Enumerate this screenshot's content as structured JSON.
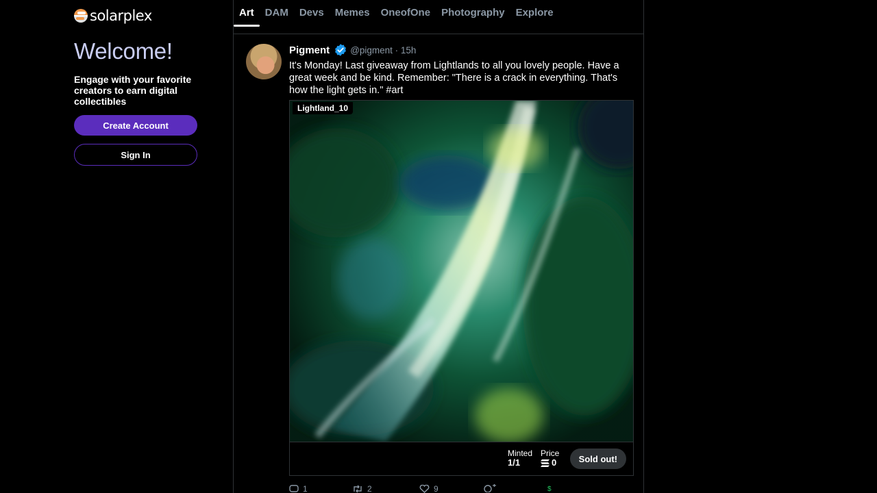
{
  "brand": {
    "name": "solarplex"
  },
  "sidebar": {
    "welcome": "Welcome!",
    "tagline": "Engage with your favorite creators to earn digital collectibles",
    "create_account": "Create Account",
    "sign_in": "Sign In"
  },
  "tabs": [
    {
      "label": "Art",
      "active": true
    },
    {
      "label": "DAM"
    },
    {
      "label": "Devs"
    },
    {
      "label": "Memes"
    },
    {
      "label": "OneofOne"
    },
    {
      "label": "Photography"
    },
    {
      "label": "Explore"
    }
  ],
  "post": {
    "author": "Pigment",
    "handle_time": "@pigment · 15h",
    "text": "It's Monday! Last giveaway from Lightlands to all you lovely people. Have a great week and be kind. Remember: \"There is a crack in everything. That's how the light gets in.\" #art",
    "media": {
      "title": "Lightland_10",
      "minted_label": "Minted",
      "minted_value": "1/1",
      "price_label": "Price",
      "price_value": "0",
      "status": "Sold out!"
    },
    "actions": {
      "reply_count": "1",
      "repost_count": "2",
      "like_count": "9"
    }
  },
  "colors": {
    "accent": "#5b2dbd",
    "verified": "#1d9bf0",
    "welcome": "#c9cdf2"
  }
}
